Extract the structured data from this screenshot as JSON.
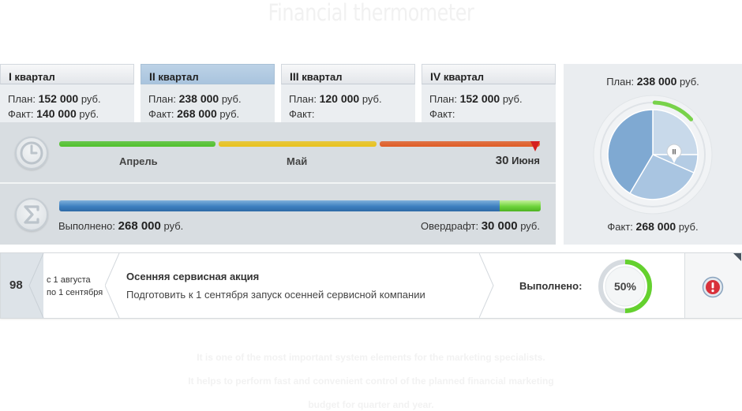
{
  "headline": "Financial thermometer",
  "quarters": [
    {
      "roman": "I",
      "label": "квартал",
      "plan_label": "План:",
      "plan_value": "152 000",
      "plan_unit": "руб.",
      "fact_label": "Факт:",
      "fact_value": "140 000",
      "fact_unit": "руб."
    },
    {
      "roman": "II",
      "label": "квартал",
      "plan_label": "План:",
      "plan_value": "238 000",
      "plan_unit": "руб.",
      "fact_label": "Факт:",
      "fact_value": "268 000",
      "fact_unit": "руб."
    },
    {
      "roman": "III",
      "label": "квартал",
      "plan_label": "План:",
      "plan_value": "120 000",
      "plan_unit": "руб.",
      "fact_label": "Факт:",
      "fact_value": "",
      "fact_unit": ""
    },
    {
      "roman": "IV",
      "label": "квартал",
      "plan_label": "План:",
      "plan_value": "152 000",
      "plan_unit": "руб.",
      "fact_label": "Факт:",
      "fact_value": "",
      "fact_unit": ""
    }
  ],
  "active_quarter": "II",
  "timeline": {
    "months": [
      "Апрель",
      "Май"
    ],
    "end_day": "30",
    "end_month": "Июня",
    "segment_colors": [
      "#4fc12a",
      "#e9c21a",
      "#e05a22"
    ]
  },
  "progress": {
    "done_label": "Выполнено:",
    "done_value": "268 000",
    "done_unit": "руб.",
    "overdraft_label": "Овердрафт:",
    "overdraft_value": "30 000",
    "overdraft_unit": "руб.",
    "done_fraction": 0.914,
    "overdraft_fraction": 0.086
  },
  "pie_panel": {
    "plan_label": "План:",
    "plan_value": "238 000",
    "plan_unit": "руб.",
    "fact_label": "Факт:",
    "fact_value": "268 000",
    "fact_unit": "руб.",
    "marker_label": "II",
    "over_fraction": 0.126
  },
  "campaign": {
    "number": "98",
    "date_from": "с 1 августа",
    "date_to": "по 1 сентября",
    "title": "Осенняя сервисная акция",
    "description": "Подготовить к 1 сентября запуск осенней сервисной компании",
    "progress_label": "Выполнено:",
    "progress_value": "50%",
    "progress_fraction": 0.5
  },
  "footer_lines": [
    "It is one of the most important system elements for the marketing specialists.",
    "It helps to perform fast and convenient control of the planned financial marketing",
    "budget for quarter and year."
  ],
  "colors": {
    "accent_blue": "#3d7fbf",
    "accent_green": "#6ed33b",
    "alert_red": "#d52020",
    "pie_light": "#c8d9ea",
    "pie_mid": "#a9c5e1",
    "pie_dark": "#7fa9d2"
  }
}
